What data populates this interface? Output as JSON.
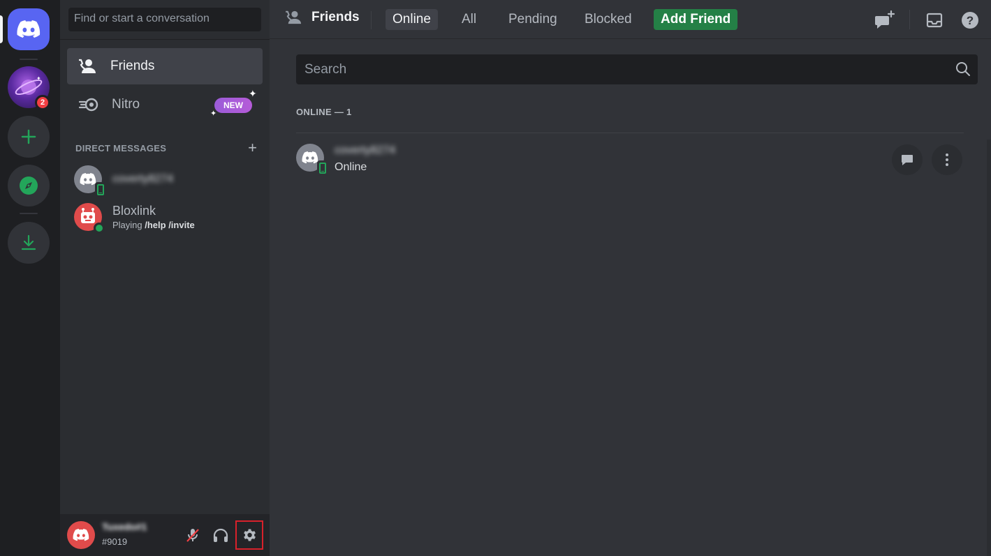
{
  "rail": {
    "servers": [
      {
        "name": "home-icon"
      },
      {
        "name": "planet-server-icon",
        "badge": "2"
      },
      {
        "name": "add-server-icon"
      },
      {
        "name": "explore-icon"
      },
      {
        "name": "download-icon"
      }
    ]
  },
  "sidebar": {
    "search_placeholder": "Find or start a conversation",
    "nav": {
      "friends": "Friends",
      "nitro": "Nitro",
      "nitro_badge": "NEW"
    },
    "dm_header": "DIRECT MESSAGES",
    "dms": [
      {
        "name": "coverty8274",
        "status": "mobile-online"
      },
      {
        "name": "Bloxlink",
        "activity_prefix": "Playing ",
        "activity": "/help /invite",
        "status": "online"
      }
    ]
  },
  "user_panel": {
    "username": "Tuxedo#1",
    "tag": "#9019"
  },
  "topbar": {
    "title": "Friends",
    "tabs": {
      "online": "Online",
      "all": "All",
      "pending": "Pending",
      "blocked": "Blocked",
      "add_friend": "Add Friend"
    }
  },
  "main": {
    "search_placeholder": "Search",
    "online_header": "ONLINE — 1",
    "friends": [
      {
        "name": "coverty8274",
        "status": "Online"
      }
    ]
  },
  "colors": {
    "accent": "#5865f2",
    "green": "#23a55a",
    "add_friend_bg": "#248046",
    "highlight_box": "#d8212b"
  }
}
